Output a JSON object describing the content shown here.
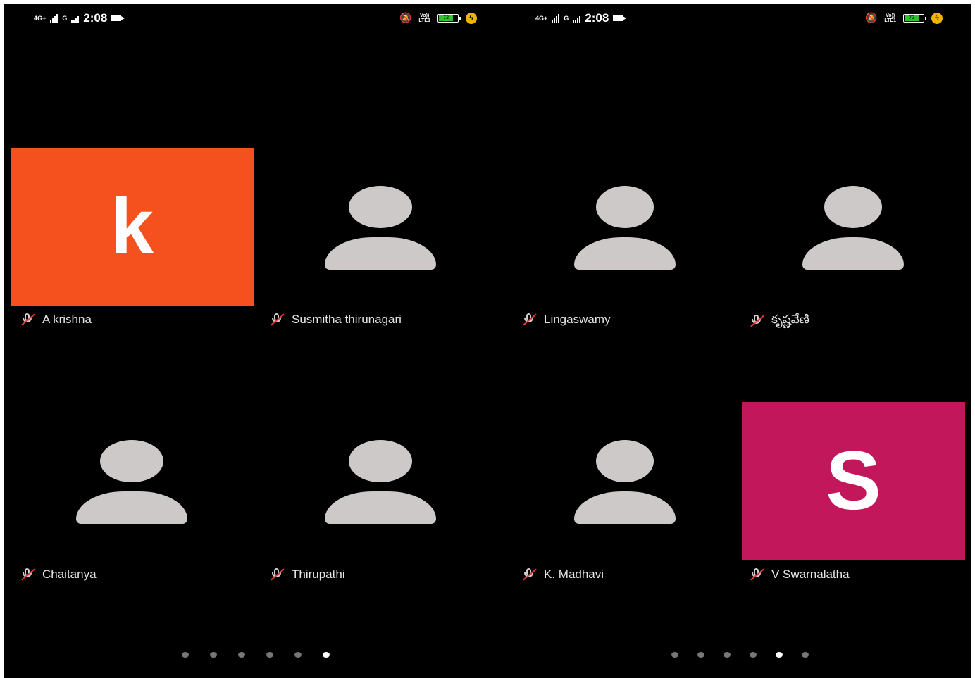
{
  "status_bar": {
    "network": "4G+",
    "network2": "G",
    "time": "2:08",
    "volte_top": "Vo))",
    "volte_bottom": "LTE1",
    "battery": "72"
  },
  "left_screen": {
    "tiles": [
      {
        "name": "A krishna",
        "avatar_letter": "k",
        "avatar_color": "#f4511e"
      },
      {
        "name": "Susmitha thirunagari"
      },
      {
        "name": "Chaitanya"
      },
      {
        "name": "Thirupathi"
      }
    ],
    "page_dots": {
      "count": 6,
      "active": 6
    }
  },
  "right_screen": {
    "tiles": [
      {
        "name": "Lingaswamy"
      },
      {
        "name": "కృష్ణవేణి"
      },
      {
        "name": "K. Madhavi"
      },
      {
        "name": "V Swarnalatha",
        "avatar_letter": "S",
        "avatar_color": "#c2185b"
      }
    ],
    "page_dots": {
      "count": 6,
      "active": 5
    }
  },
  "icons": {
    "muted_mic": "mic-off-icon",
    "placeholder_avatar": "person-icon"
  },
  "colors": {
    "background": "#000000",
    "placeholder": "#cdc9c9",
    "mute_slash": "#e53935"
  }
}
